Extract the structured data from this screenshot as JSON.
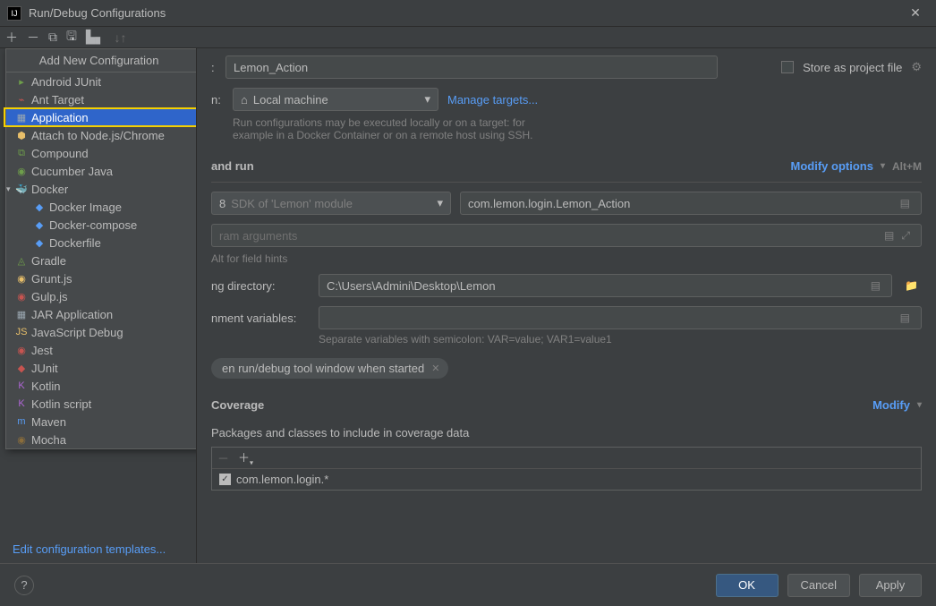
{
  "window": {
    "title": "Run/Debug Configurations"
  },
  "dropdown": {
    "header": "Add New Configuration",
    "items": [
      {
        "label": "Android JUnit",
        "icon": "▸",
        "color": "#6e9e4b"
      },
      {
        "label": "Ant Target",
        "icon": "⌁",
        "color": "#c75450"
      },
      {
        "label": "Application",
        "icon": "▦",
        "color": "#9aa7b0",
        "selected": true
      },
      {
        "label": "Attach to Node.js/Chrome",
        "icon": "⬢",
        "color": "#e8bf6a"
      },
      {
        "label": "Compound",
        "icon": "⧉",
        "color": "#6e9e4b"
      },
      {
        "label": "Cucumber Java",
        "icon": "◉",
        "color": "#6e9e4b"
      },
      {
        "label": "Docker",
        "icon": "🐳",
        "color": "#589df6",
        "expandable": true
      },
      {
        "label": "Docker Image",
        "icon": "◆",
        "color": "#589df6",
        "child": true
      },
      {
        "label": "Docker-compose",
        "icon": "◆",
        "color": "#589df6",
        "child": true
      },
      {
        "label": "Dockerfile",
        "icon": "◆",
        "color": "#589df6",
        "child": true
      },
      {
        "label": "Gradle",
        "icon": "◬",
        "color": "#6e9e4b"
      },
      {
        "label": "Grunt.js",
        "icon": "◉",
        "color": "#e8bf6a"
      },
      {
        "label": "Gulp.js",
        "icon": "◉",
        "color": "#c75450"
      },
      {
        "label": "JAR Application",
        "icon": "▦",
        "color": "#9aa7b0"
      },
      {
        "label": "JavaScript Debug",
        "icon": "JS",
        "color": "#e8bf6a"
      },
      {
        "label": "Jest",
        "icon": "◉",
        "color": "#c75450"
      },
      {
        "label": "JUnit",
        "icon": "◆",
        "color": "#c75450"
      },
      {
        "label": "Kotlin",
        "icon": "K",
        "color": "#b066d6"
      },
      {
        "label": "Kotlin script",
        "icon": "K",
        "color": "#b066d6"
      },
      {
        "label": "Maven",
        "icon": "m",
        "color": "#589df6"
      },
      {
        "label": "Mocha",
        "icon": "◉",
        "color": "#8a6d3b"
      }
    ]
  },
  "form": {
    "name_label_suffix": ":",
    "name_value": "Lemon_Action",
    "store_label": "Store as project file",
    "run_on_suffix": "n:",
    "run_on_value": "Local machine",
    "manage_targets": "Manage targets...",
    "run_on_hint1": "Run configurations may be executed locally or on a target: for",
    "run_on_hint2": "example in a Docker Container or on a remote host using SSH.",
    "section_build": "and run",
    "modify_options": "Modify options",
    "modify_shortcut": "Alt+M",
    "jdk_prefix": "8",
    "jdk_value": "SDK of 'Lemon' module",
    "main_class": "com.lemon.login.Lemon_Action",
    "program_args_placeholder": "ram arguments",
    "field_hints": "Alt for field hints",
    "wd_label": "ng directory:",
    "wd_value": "C:\\Users\\Admini\\Desktop\\Lemon",
    "env_label": "nment variables:",
    "env_hint": "Separate variables with semicolon: VAR=value; VAR1=value1",
    "pill_text": "en run/debug tool window when started",
    "coverage_header": "Coverage",
    "modify_label": "Modify",
    "coverage_hint": "Packages and classes to include in coverage data",
    "coverage_pkg": "com.lemon.login.*"
  },
  "footer": {
    "edit_templates": "Edit configuration templates...",
    "ok": "OK",
    "cancel": "Cancel",
    "apply": "Apply"
  }
}
